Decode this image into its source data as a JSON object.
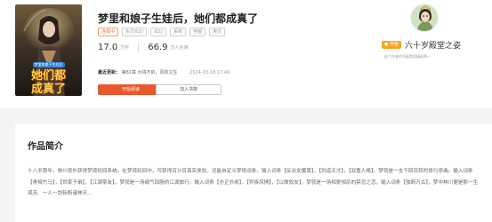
{
  "book": {
    "title": "梦里和娘子生娃后，她们都成真了",
    "cover_text_line1": "她们都",
    "cover_text_line2": "成真了",
    "cover_top_text": "梦里和娘子生娃后",
    "tags": [
      "连载中",
      "东方玄幻",
      "玄幻",
      "系统",
      "穿越",
      "爽文"
    ],
    "word_count": "17.0",
    "word_count_unit": "万字",
    "readers": "66.9",
    "readers_unit": "万人在读",
    "latest_label": "最近更新:",
    "latest_chapter": "第81章 大将不依，风吹又生",
    "latest_time": "2024-03-18 17:49",
    "read_button": "开始阅读",
    "shelf_button": "加入书架"
  },
  "author": {
    "badge": "作者",
    "name": "六十岁殿堂之姿",
    "desc": "这个作者的书真是很精彩哦~"
  },
  "intro": {
    "title": "作品简介",
    "text": "十八岁那年，林川意外获得梦境轮回系统。在梦境轮回中，可获得百分百真实体验，还能自定义梦境词条。输入词条【反派女魔尊】，【剑道天才】，【双重人格】，梦就是一支千回百转的修行序曲。输入词条【青梅竹马】，【世家子弟】，【江湖掌友】，梦就是一场痛气回肠的江湖旅行。输入词条【亦正亦邪】，【异族风情】，【以故叙友】，梦就是一场相爱相杀的禁忌之恋。输入词条【独断万古】，梦中林川便是那一生孤苦、一人一剑斩断诸神天..."
  },
  "colors": {
    "accent": "#e9572c",
    "badge": "#f5a623"
  }
}
